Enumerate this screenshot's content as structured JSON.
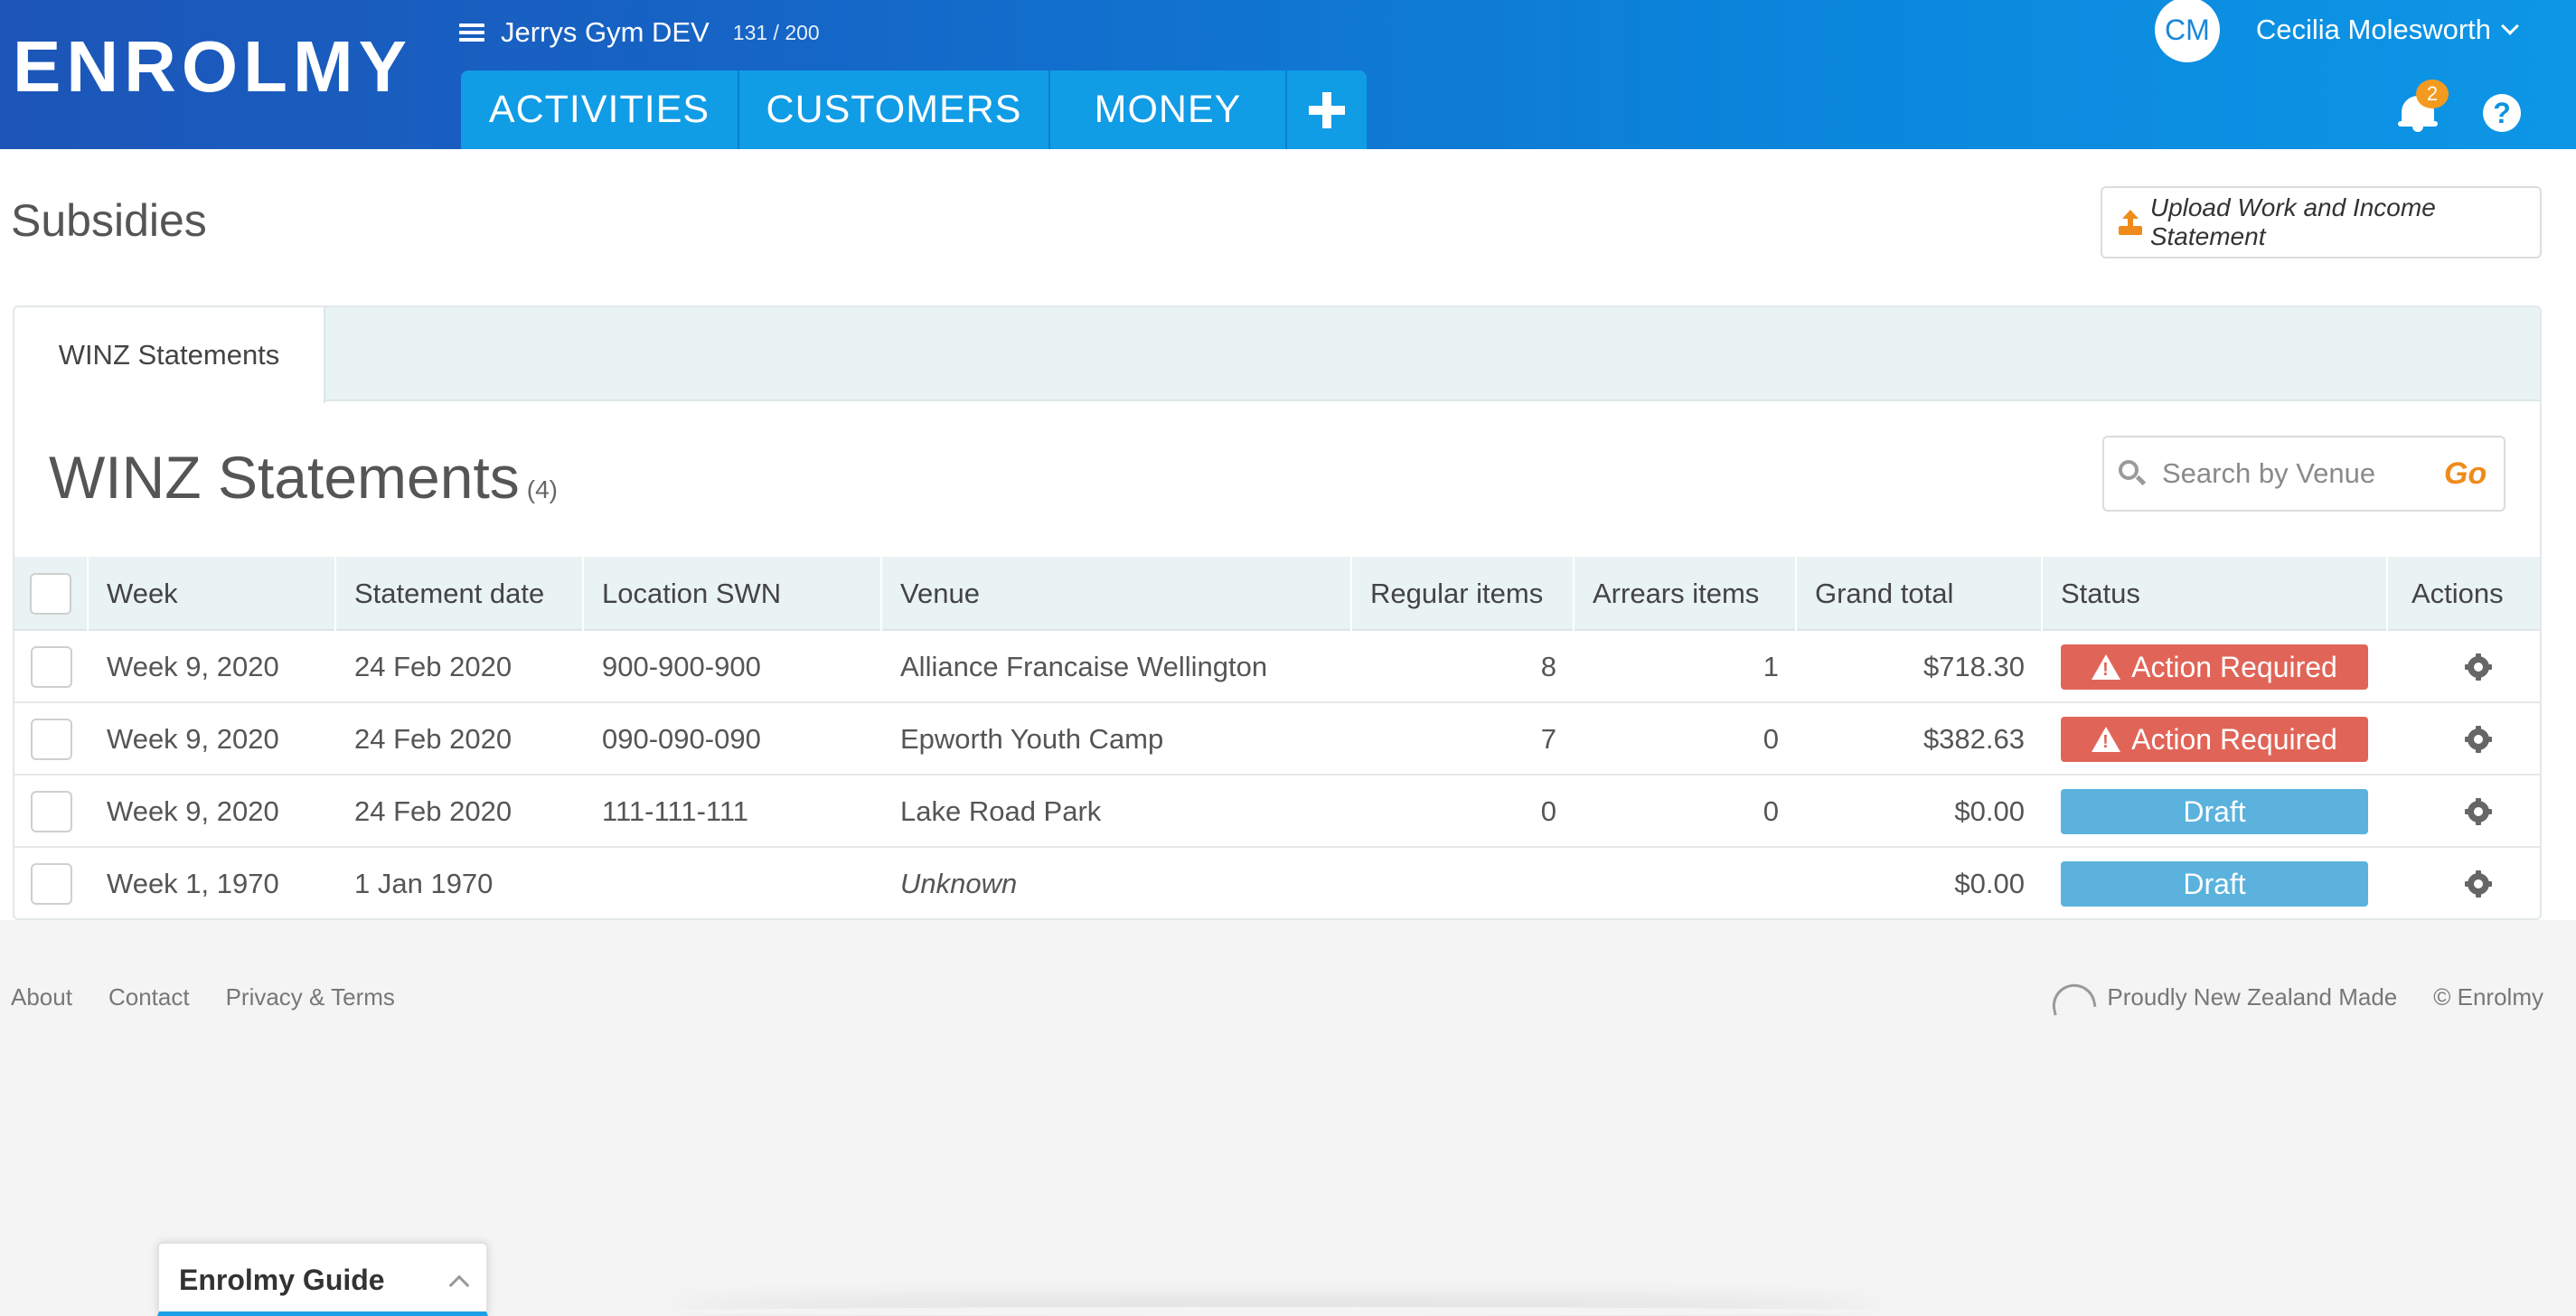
{
  "brand": {
    "logo": "ENROLMY"
  },
  "org": {
    "name": "Jerrys Gym DEV",
    "count": "131 / 200"
  },
  "nav": {
    "tabs": [
      "ACTIVITIES",
      "CUSTOMERS",
      "MONEY"
    ]
  },
  "user": {
    "initials": "CM",
    "name": "Cecilia Molesworth",
    "notifications": "2",
    "help": "?"
  },
  "page": {
    "title": "Subsidies",
    "upload_label": "Upload Work and Income Statement"
  },
  "panel": {
    "tab_label": "WINZ Statements",
    "section_title": "WINZ Statements",
    "section_count": "(4)",
    "search": {
      "placeholder": "Search by Venue",
      "go_label": "Go"
    }
  },
  "table": {
    "headers": [
      "Week",
      "Statement date",
      "Location SWN",
      "Venue",
      "Regular items",
      "Arrears items",
      "Grand total",
      "Status",
      "Actions"
    ],
    "rows": [
      {
        "week": "Week 9, 2020",
        "date": "24 Feb 2020",
        "swn": "900-900-900",
        "venue": "Alliance Francaise Wellington",
        "regular": "8",
        "arrears": "1",
        "total": "$718.30",
        "status": "Action Required"
      },
      {
        "week": "Week 9, 2020",
        "date": "24 Feb 2020",
        "swn": "090-090-090",
        "venue": "Epworth Youth Camp",
        "regular": "7",
        "arrears": "0",
        "total": "$382.63",
        "status": "Action Required"
      },
      {
        "week": "Week 9, 2020",
        "date": "24 Feb 2020",
        "swn": "111-111-111",
        "venue": "Lake Road Park",
        "regular": "0",
        "arrears": "0",
        "total": "$0.00",
        "status": "Draft"
      },
      {
        "week": "Week 1, 1970",
        "date": "1 Jan 1970",
        "swn": "",
        "venue": "Unknown",
        "regular": "",
        "arrears": "",
        "total": "$0.00",
        "status": "Draft"
      }
    ]
  },
  "footer": {
    "links": [
      "About",
      "Contact",
      "Privacy & Terms"
    ],
    "made": "Proudly New Zealand Made",
    "copyright": "© Enrolmy"
  },
  "guide": {
    "title": "Enrolmy Guide"
  },
  "colors": {
    "header_start": "#1d55b8",
    "header_end": "#0d96e6",
    "nav_tab": "#119ce6",
    "accent_orange": "#ef8b1a",
    "status_action_required": "#e06558",
    "status_draft": "#5ab2dd"
  },
  "icons": [
    "hamburger-icon",
    "plus-icon",
    "chevron-down-icon",
    "bell-icon",
    "help-icon",
    "upload-icon",
    "search-icon",
    "warning-icon",
    "gear-icon",
    "kiwi-icon",
    "chevron-up-icon"
  ]
}
